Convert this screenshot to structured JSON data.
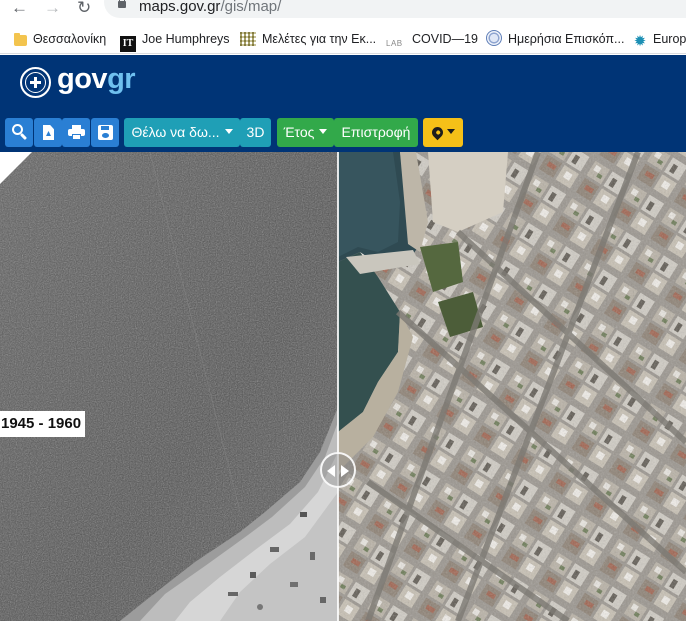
{
  "browser": {
    "url_host": "maps.gov.gr",
    "url_path": "/gis/map/",
    "bookmarks": [
      {
        "label": "Θεσσαλονίκη",
        "icon": "folder-icon"
      },
      {
        "label": "Joe Humphreys",
        "icon": "irish-times-icon"
      },
      {
        "label": "Μελέτες για την Εκ...",
        "icon": "site-icon"
      },
      {
        "label": "COVID—19",
        "icon": "lab-icon",
        "badge": "LAB"
      },
      {
        "label": "Ημερήσια Επισκόπ...",
        "icon": "seal-icon"
      },
      {
        "label": "Europ",
        "icon": "gear-icon"
      }
    ]
  },
  "header": {
    "logo_main": "gov",
    "logo_accent": "gr",
    "colors": {
      "background": "#003476",
      "accent": "#6fc0ef"
    }
  },
  "toolbar": {
    "icon_buttons": [
      "search-icon",
      "file-icon",
      "print-icon",
      "save-icon"
    ],
    "want_to_label": "Θέλω να δω...",
    "mode_3d_label": "3D",
    "year_label": "Έτος",
    "back_label": "Επιστροφή",
    "location_icon": "map-marker-icon",
    "colors": {
      "blue": "#2a7fd4",
      "teal": "#1f9fb6",
      "green": "#32a94a",
      "yellow": "#f5c018"
    }
  },
  "map": {
    "left_year_range": "1945 - 1960"
  }
}
